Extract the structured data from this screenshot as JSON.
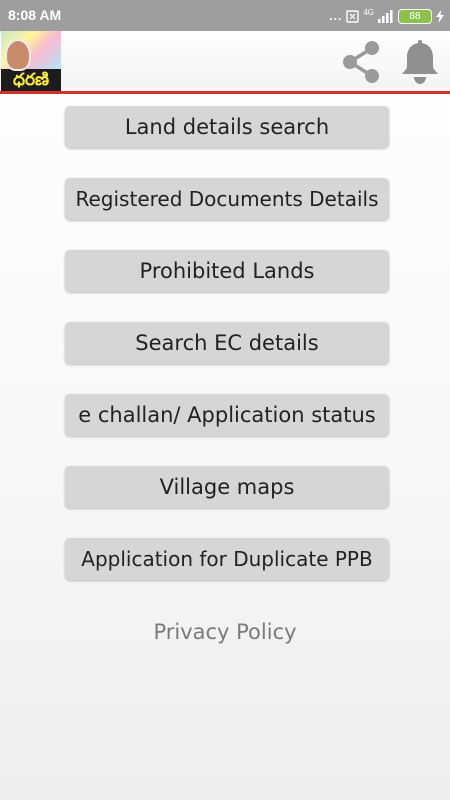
{
  "status_bar": {
    "time": "8:08 AM",
    "dots": "...",
    "network": "4G",
    "battery": "88"
  },
  "app_bar": {
    "logo_text": "ధరణి",
    "share_icon": "share-icon",
    "bell_icon": "bell-icon"
  },
  "menu": {
    "items": [
      {
        "label": "Land details search"
      },
      {
        "label": "Registered Documents Details"
      },
      {
        "label": "Prohibited Lands"
      },
      {
        "label": "Search EC details"
      },
      {
        "label": "e challan/ Application status"
      },
      {
        "label": "Village maps"
      },
      {
        "label": "Application for Duplicate PPB"
      }
    ]
  },
  "privacy_policy": "Privacy Policy",
  "colors": {
    "accent_line": "#d32f2f",
    "button_bg": "#d6d6d6",
    "battery": "#8bc34a"
  }
}
